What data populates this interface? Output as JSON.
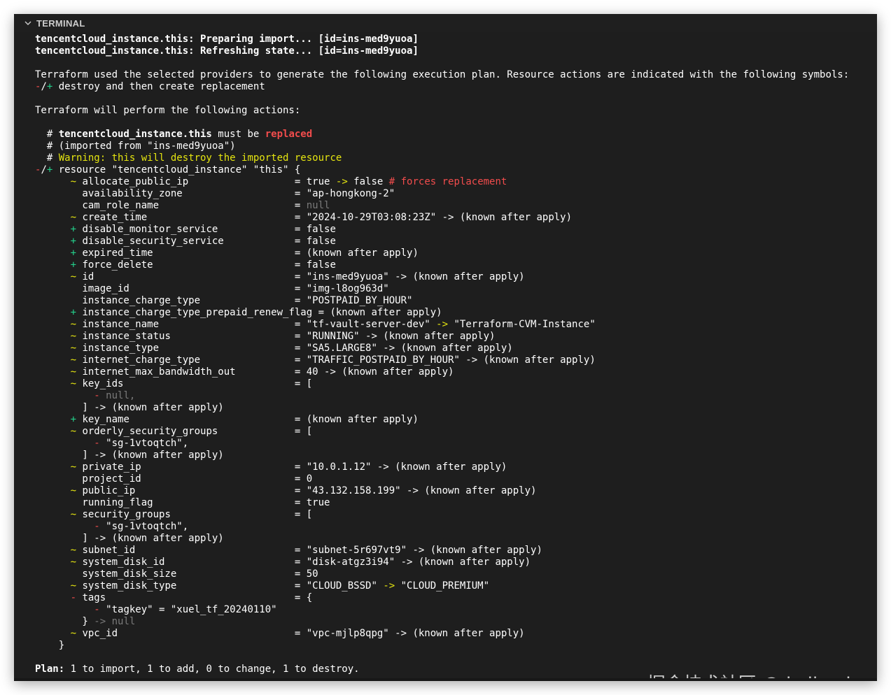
{
  "panel": {
    "title": "TERMINAL",
    "collapse_icon": "chevron-down-icon"
  },
  "terminal": {
    "lines": [
      [
        {
          "t": "tencentcloud_instance.this: Preparing import... [id=ins-med9yuoa]",
          "c": "b"
        }
      ],
      [
        {
          "t": "tencentcloud_instance.this: Refreshing state... [id=ins-med9yuoa]",
          "c": "b"
        }
      ],
      [],
      [
        {
          "t": "Terraform used the selected providers to generate the following execution plan. Resource actions are indicated with the following symbols:",
          "c": "w"
        }
      ],
      [
        {
          "t": "-",
          "c": "r"
        },
        {
          "t": "/",
          "c": "w"
        },
        {
          "t": "+",
          "c": "g"
        },
        {
          "t": " destroy and then create replacement",
          "c": "w"
        }
      ],
      [],
      [
        {
          "t": "Terraform will perform the following actions:",
          "c": "w"
        }
      ],
      [],
      [
        {
          "t": "  # ",
          "c": "w"
        },
        {
          "t": "tencentcloud_instance.this",
          "c": "b"
        },
        {
          "t": " must be ",
          "c": "w"
        },
        {
          "t": "replaced",
          "c": "rb"
        }
      ],
      [
        {
          "t": "  # (imported from \"ins-med9yuoa\")",
          "c": "w"
        }
      ],
      [
        {
          "t": "  # ",
          "c": "w"
        },
        {
          "t": "Warning: this will destroy the imported resource",
          "c": "y"
        }
      ],
      [
        {
          "t": "-",
          "c": "r"
        },
        {
          "t": "/",
          "c": "w"
        },
        {
          "t": "+",
          "c": "g"
        },
        {
          "t": " resource \"tencentcloud_instance\" \"this\" {",
          "c": "w"
        }
      ],
      [
        {
          "t": "      ",
          "c": "w"
        },
        {
          "t": "~",
          "c": "y"
        },
        {
          "t": " allocate_public_ip                  = true ",
          "c": "w"
        },
        {
          "t": "->",
          "c": "y"
        },
        {
          "t": " false ",
          "c": "w"
        },
        {
          "t": "# forces replacement",
          "c": "r"
        }
      ],
      [
        {
          "t": "        availability_zone                   = \"ap-hongkong-2\"",
          "c": "w"
        }
      ],
      [
        {
          "t": "        cam_role_name                       = ",
          "c": "w"
        },
        {
          "t": "null",
          "c": "gr"
        }
      ],
      [
        {
          "t": "      ",
          "c": "w"
        },
        {
          "t": "~",
          "c": "y"
        },
        {
          "t": " create_time                         = \"2024-10-29T03:08:23Z\" -> (known after apply)",
          "c": "w"
        }
      ],
      [
        {
          "t": "      ",
          "c": "w"
        },
        {
          "t": "+",
          "c": "g"
        },
        {
          "t": " disable_monitor_service             = false",
          "c": "w"
        }
      ],
      [
        {
          "t": "      ",
          "c": "w"
        },
        {
          "t": "+",
          "c": "g"
        },
        {
          "t": " disable_security_service            = false",
          "c": "w"
        }
      ],
      [
        {
          "t": "      ",
          "c": "w"
        },
        {
          "t": "+",
          "c": "g"
        },
        {
          "t": " expired_time                        = (known after apply)",
          "c": "w"
        }
      ],
      [
        {
          "t": "      ",
          "c": "w"
        },
        {
          "t": "+",
          "c": "g"
        },
        {
          "t": " force_delete                        = false",
          "c": "w"
        }
      ],
      [
        {
          "t": "      ",
          "c": "w"
        },
        {
          "t": "~",
          "c": "y"
        },
        {
          "t": " id                                  = \"ins-med9yuoa\" -> (known after apply)",
          "c": "w"
        }
      ],
      [
        {
          "t": "        image_id                            = \"img-l8og963d\"",
          "c": "w"
        }
      ],
      [
        {
          "t": "        instance_charge_type                = \"POSTPAID_BY_HOUR\"",
          "c": "w"
        }
      ],
      [
        {
          "t": "      ",
          "c": "w"
        },
        {
          "t": "+",
          "c": "g"
        },
        {
          "t": " instance_charge_type_prepaid_renew_flag = (known after apply)",
          "c": "w"
        }
      ],
      [
        {
          "t": "      ",
          "c": "w"
        },
        {
          "t": "~",
          "c": "y"
        },
        {
          "t": " instance_name                       = \"tf-vault-server-dev\" ",
          "c": "w"
        },
        {
          "t": "->",
          "c": "y"
        },
        {
          "t": " \"Terraform-CVM-Instance\"",
          "c": "w"
        }
      ],
      [
        {
          "t": "      ",
          "c": "w"
        },
        {
          "t": "~",
          "c": "y"
        },
        {
          "t": " instance_status                     = \"RUNNING\" -> (known after apply)",
          "c": "w"
        }
      ],
      [
        {
          "t": "      ",
          "c": "w"
        },
        {
          "t": "~",
          "c": "y"
        },
        {
          "t": " instance_type                       = \"SA5.LARGE8\" -> (known after apply)",
          "c": "w"
        }
      ],
      [
        {
          "t": "      ",
          "c": "w"
        },
        {
          "t": "~",
          "c": "y"
        },
        {
          "t": " internet_charge_type                = \"TRAFFIC_POSTPAID_BY_HOUR\" -> (known after apply)",
          "c": "w"
        }
      ],
      [
        {
          "t": "      ",
          "c": "w"
        },
        {
          "t": "~",
          "c": "y"
        },
        {
          "t": " internet_max_bandwidth_out          = 40 -> (known after apply)",
          "c": "w"
        }
      ],
      [
        {
          "t": "      ",
          "c": "w"
        },
        {
          "t": "~",
          "c": "y"
        },
        {
          "t": " key_ids                             = [",
          "c": "w"
        }
      ],
      [
        {
          "t": "          ",
          "c": "w"
        },
        {
          "t": "-",
          "c": "r"
        },
        {
          "t": " null,",
          "c": "gr"
        }
      ],
      [
        {
          "t": "        ] -> (known after apply)",
          "c": "w"
        }
      ],
      [
        {
          "t": "      ",
          "c": "w"
        },
        {
          "t": "+",
          "c": "g"
        },
        {
          "t": " key_name                            = (known after apply)",
          "c": "w"
        }
      ],
      [
        {
          "t": "      ",
          "c": "w"
        },
        {
          "t": "~",
          "c": "y"
        },
        {
          "t": " orderly_security_groups             = [",
          "c": "w"
        }
      ],
      [
        {
          "t": "          ",
          "c": "w"
        },
        {
          "t": "-",
          "c": "r"
        },
        {
          "t": " \"sg-1vtoqtch\",",
          "c": "w"
        }
      ],
      [
        {
          "t": "        ] -> (known after apply)",
          "c": "w"
        }
      ],
      [
        {
          "t": "      ",
          "c": "w"
        },
        {
          "t": "~",
          "c": "y"
        },
        {
          "t": " private_ip                          = \"10.0.1.12\" -> (known after apply)",
          "c": "w"
        }
      ],
      [
        {
          "t": "        project_id                          = 0",
          "c": "w"
        }
      ],
      [
        {
          "t": "      ",
          "c": "w"
        },
        {
          "t": "~",
          "c": "y"
        },
        {
          "t": " public_ip                           = \"43.132.158.199\" -> (known after apply)",
          "c": "w"
        }
      ],
      [
        {
          "t": "        running_flag                        = true",
          "c": "w"
        }
      ],
      [
        {
          "t": "      ",
          "c": "w"
        },
        {
          "t": "~",
          "c": "y"
        },
        {
          "t": " security_groups                     = [",
          "c": "w"
        }
      ],
      [
        {
          "t": "          ",
          "c": "w"
        },
        {
          "t": "-",
          "c": "r"
        },
        {
          "t": " \"sg-1vtoqtch\",",
          "c": "w"
        }
      ],
      [
        {
          "t": "        ] -> (known after apply)",
          "c": "w"
        }
      ],
      [
        {
          "t": "      ",
          "c": "w"
        },
        {
          "t": "~",
          "c": "y"
        },
        {
          "t": " subnet_id                           = \"subnet-5r697vt9\" -> (known after apply)",
          "c": "w"
        }
      ],
      [
        {
          "t": "      ",
          "c": "w"
        },
        {
          "t": "~",
          "c": "y"
        },
        {
          "t": " system_disk_id                      = \"disk-atgz3i94\" -> (known after apply)",
          "c": "w"
        }
      ],
      [
        {
          "t": "        system_disk_size                    = 50",
          "c": "w"
        }
      ],
      [
        {
          "t": "      ",
          "c": "w"
        },
        {
          "t": "~",
          "c": "y"
        },
        {
          "t": " system_disk_type                    = \"CLOUD_BSSD\" ",
          "c": "w"
        },
        {
          "t": "->",
          "c": "y"
        },
        {
          "t": " \"CLOUD_PREMIUM\"",
          "c": "w"
        }
      ],
      [
        {
          "t": "      ",
          "c": "w"
        },
        {
          "t": "-",
          "c": "r"
        },
        {
          "t": " tags                                = {",
          "c": "w"
        }
      ],
      [
        {
          "t": "          ",
          "c": "w"
        },
        {
          "t": "-",
          "c": "r"
        },
        {
          "t": " \"tagkey\" = \"xuel_tf_20240110\"",
          "c": "w"
        }
      ],
      [
        {
          "t": "        } ",
          "c": "w"
        },
        {
          "t": "-> null",
          "c": "gr"
        }
      ],
      [
        {
          "t": "      ",
          "c": "w"
        },
        {
          "t": "~",
          "c": "y"
        },
        {
          "t": " vpc_id                              = \"vpc-mjlp8qpg\" -> (known after apply)",
          "c": "w"
        }
      ],
      [
        {
          "t": "    }",
          "c": "w"
        }
      ],
      [],
      [
        {
          "t": "Plan:",
          "c": "b"
        },
        {
          "t": " 1 to import, 1 to add, 0 to change, 1 to destroy.",
          "c": "w"
        }
      ]
    ]
  },
  "watermark": "掘金技术社区 @ kaliarch",
  "colors": {
    "panel_bg": "#1e1e1e",
    "text": "#cccccc",
    "yellow": "#e5e510",
    "red": "#f14c4c",
    "green": "#23d18b",
    "gray": "#7a7a7a"
  }
}
